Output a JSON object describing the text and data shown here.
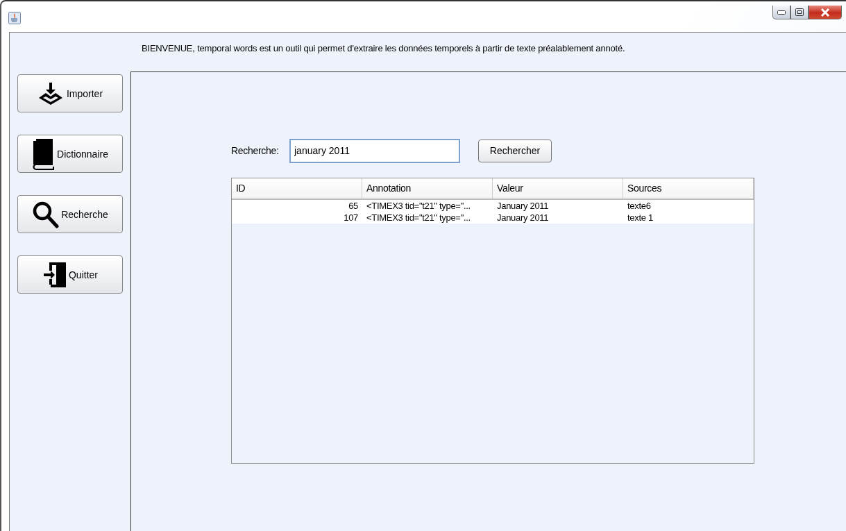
{
  "welcome": "BIENVENUE, temporal words est un outil qui permet d'extraire les données temporels à partir de texte préalablement annoté.",
  "sidebar": [
    {
      "kind": "import",
      "label": "Importer"
    },
    {
      "kind": "book",
      "label": "Dictionnaire"
    },
    {
      "kind": "search",
      "label": "Recherche"
    },
    {
      "kind": "exit",
      "label": "Quitter"
    }
  ],
  "search": {
    "label": "Recherche:",
    "value": "january 2011",
    "button": "Rechercher"
  },
  "table": {
    "columns": [
      "ID",
      "Annotation",
      "Valeur",
      "Sources"
    ],
    "rows": [
      [
        "65",
        "<TIMEX3 tid=\"t21\" type=\"...",
        "January 2011",
        "texte6"
      ],
      [
        "107",
        "<TIMEX3 tid=\"t21\" type=\"...",
        "January 2011",
        "texte 1"
      ]
    ]
  }
}
